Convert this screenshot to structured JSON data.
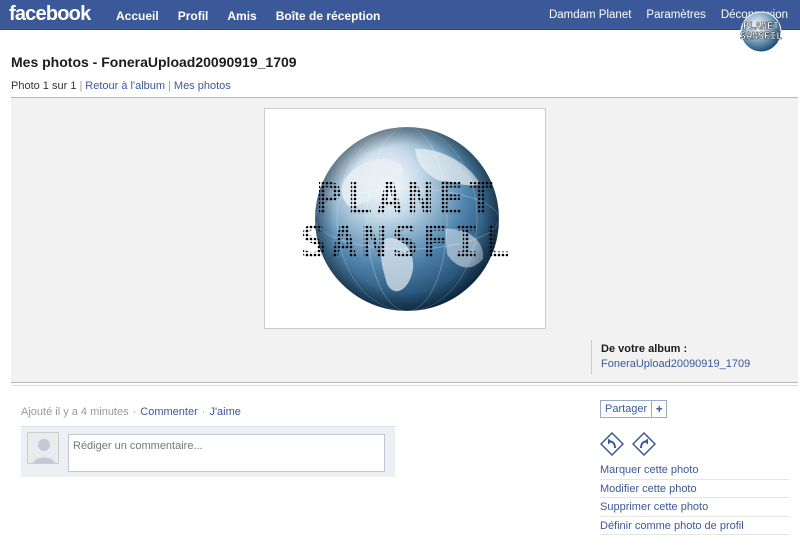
{
  "topbar": {
    "logo": "facebook",
    "nav_left": [
      "Accueil",
      "Profil",
      "Amis",
      "Boîte de réception"
    ],
    "nav_right": [
      "Damdam Planet",
      "Paramètres",
      "Déconnexion"
    ]
  },
  "watermark": {
    "line1": "PLANET",
    "line2": "SANSFIL"
  },
  "page": {
    "title": "Mes photos - FoneraUpload20090919_1709",
    "counter": "Photo 1 sur 1",
    "back_link": "Retour à l'album",
    "my_photos_link": "Mes photos"
  },
  "photo": {
    "logo_line1": "PLANET",
    "logo_line2": "SANSFIL"
  },
  "album": {
    "label": "De votre album :",
    "name": "FoneraUpload20090919_1709"
  },
  "meta": {
    "added": "Ajouté il y a 4 minutes",
    "comment_link": "Commenter",
    "like_link": "J'aime"
  },
  "comment": {
    "placeholder": "Rédiger un commentaire..."
  },
  "share": {
    "label": "Partager",
    "plus": "+"
  },
  "actions": [
    "Marquer cette photo",
    "Modifier cette photo",
    "Supprimer cette photo",
    "Définir comme photo de profil"
  ],
  "colors": {
    "brand_blue": "#3b5998",
    "photo_bg": "#f2f2f2",
    "comment_bg": "#edeff4"
  }
}
